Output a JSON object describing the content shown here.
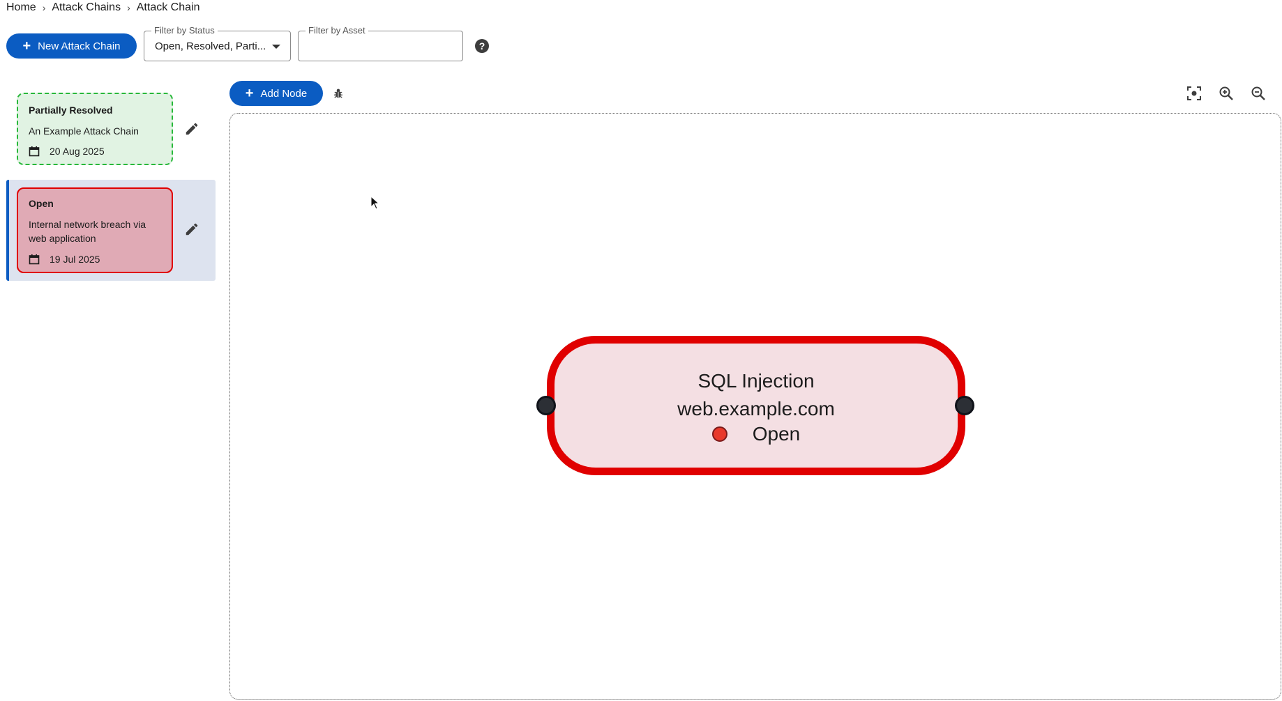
{
  "breadcrumb": {
    "items": [
      "Home",
      "Attack Chains",
      "Attack Chain"
    ],
    "separator": "›"
  },
  "toolbar": {
    "new_chain_label": "New Attack Chain",
    "status_filter": {
      "label": "Filter by Status",
      "value": "Open, Resolved, Parti..."
    },
    "asset_filter": {
      "label": "Filter by Asset",
      "value": ""
    },
    "help_symbol": "?"
  },
  "chains": [
    {
      "status": "Partially Resolved",
      "title": "An Example Attack Chain",
      "date": "20 Aug 2025",
      "style": "resolved"
    },
    {
      "status": "Open",
      "title": "Internal network breach via web application",
      "date": "19 Jul 2025",
      "style": "open",
      "selected": true
    }
  ],
  "canvas_toolbar": {
    "add_node_label": "Add Node",
    "icons": [
      "bug-icon",
      "fit-view-icon",
      "zoom-in-icon",
      "zoom-out-icon"
    ]
  },
  "node": {
    "title": "SQL Injection",
    "asset": "web.example.com",
    "status": "Open"
  },
  "colors": {
    "primary": "#0b5cc2",
    "open_border": "#e00000",
    "open_fill": "#e0aab5",
    "resolved_border": "#28b83a",
    "resolved_fill": "#e1f3e3",
    "selected_row": "#dde3ef",
    "node_fill": "#f4dfe3",
    "status_dot": "#e8392b"
  }
}
